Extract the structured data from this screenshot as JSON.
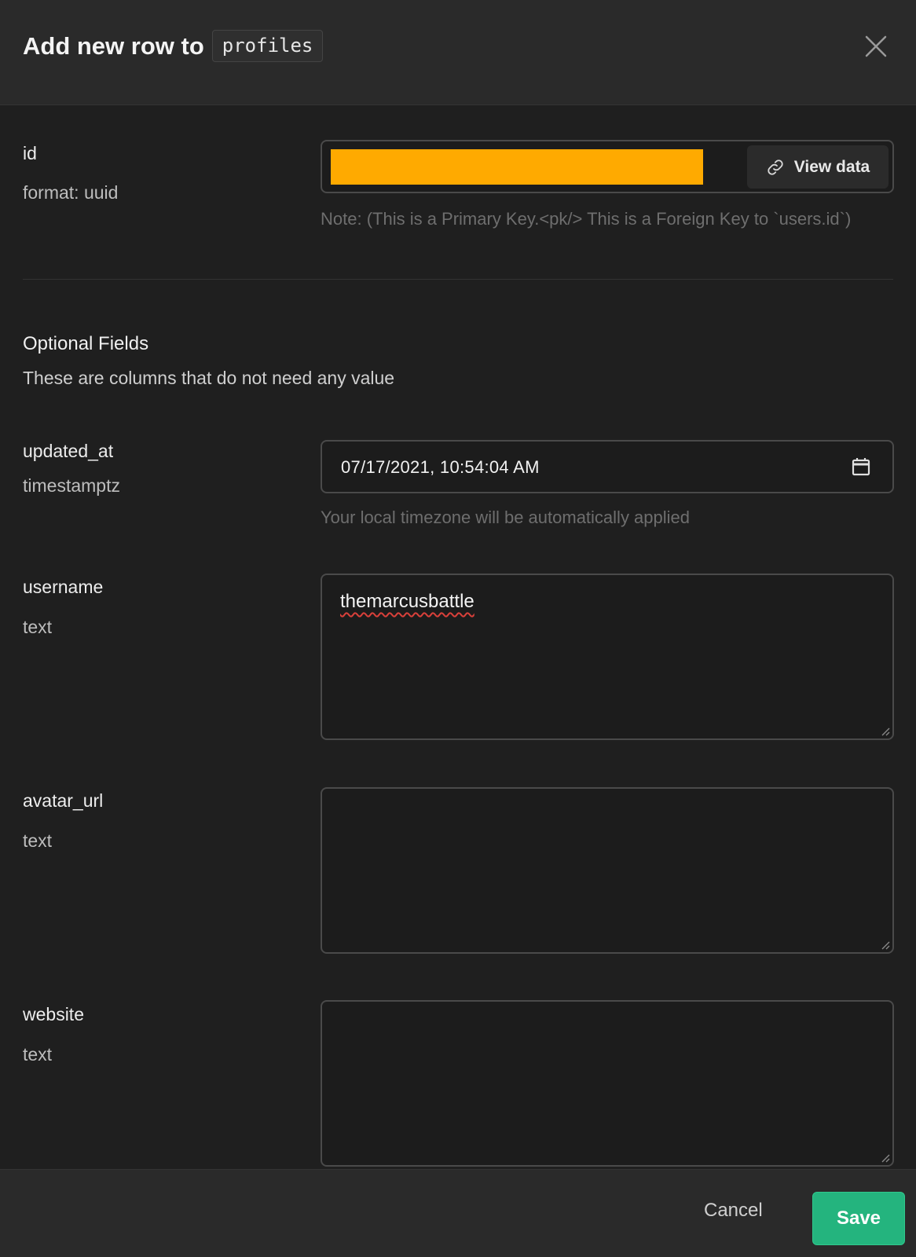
{
  "header": {
    "title": "Add new row to",
    "table_name": "profiles",
    "close_icon": "close-icon"
  },
  "id_field": {
    "label": "id",
    "format": "format: uuid",
    "value_redacted_color": "#ffaa00",
    "view_data_label": "View data",
    "view_data_icon": "link-icon",
    "note": "Note: (This is a Primary Key.<pk/> This is a Foreign Key to `users.id`)"
  },
  "optional": {
    "title": "Optional Fields",
    "description": "These are columns that do not need any value"
  },
  "updated_at": {
    "label": "updated_at",
    "type": "timestamptz",
    "value": "07/17/2021, 10:54:04 AM",
    "icon": "calendar-icon",
    "note": "Your local timezone will be automatically applied"
  },
  "username": {
    "label": "username",
    "type": "text",
    "value": "themarcusbattle"
  },
  "avatar_url": {
    "label": "avatar_url",
    "type": "text",
    "value": ""
  },
  "website": {
    "label": "website",
    "type": "text",
    "value": ""
  },
  "footer": {
    "cancel_label": "Cancel",
    "save_label": "Save",
    "save_color": "#24b47e"
  }
}
